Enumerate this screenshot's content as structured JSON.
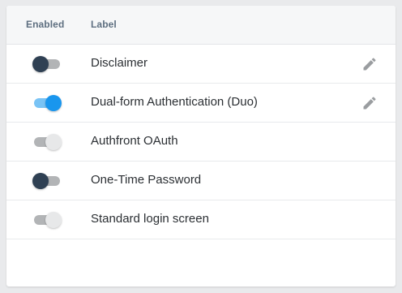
{
  "table": {
    "headers": {
      "enabled": "Enabled",
      "label": "Label"
    },
    "rows": [
      {
        "label": "Disclaimer",
        "enabled": false,
        "toggle_style": "off-dark",
        "editable": true
      },
      {
        "label": "Dual-form Authentication (Duo)",
        "enabled": true,
        "toggle_style": "on",
        "editable": true
      },
      {
        "label": "Authfront OAuth",
        "enabled": false,
        "toggle_style": "off-light",
        "editable": false
      },
      {
        "label": "One-Time Password",
        "enabled": false,
        "toggle_style": "off-dark",
        "editable": false
      },
      {
        "label": "Standard login screen",
        "enabled": false,
        "toggle_style": "off-light",
        "editable": false
      }
    ]
  },
  "icons": {
    "edit": "pencil-icon"
  },
  "colors": {
    "toggle_on_thumb": "#1996ee",
    "toggle_on_track": "#79c3f5",
    "toggle_off_dark_thumb": "#2f4053",
    "toggle_off_light_thumb": "#e7e8e9",
    "toggle_off_track": "#b2b4b6",
    "header_text": "#5e6f80",
    "edit_icon": "#9a9da0"
  }
}
